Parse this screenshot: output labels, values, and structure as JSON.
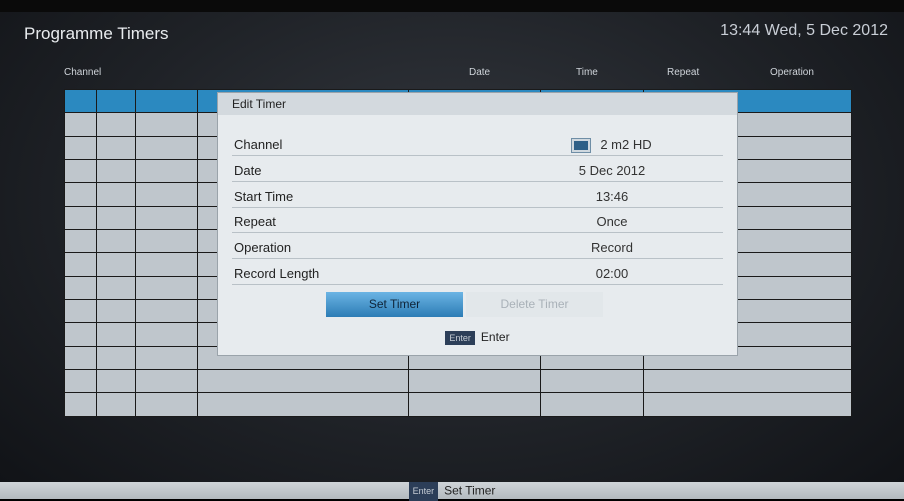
{
  "header": {
    "title": "Programme Timers",
    "clock": "13:44 Wed, 5 Dec 2012"
  },
  "table": {
    "columns": [
      "Channel",
      "Date",
      "Time",
      "Repeat",
      "Operation"
    ]
  },
  "dialog": {
    "title": "Edit Timer",
    "fields": [
      {
        "label": "Channel",
        "value": "2 m2 HD"
      },
      {
        "label": "Date",
        "value": "5 Dec 2012"
      },
      {
        "label": "Start Time",
        "value": "13:46"
      },
      {
        "label": "Repeat",
        "value": "Once"
      },
      {
        "label": "Operation",
        "value": "Record"
      },
      {
        "label": "Record Length",
        "value": "02:00"
      }
    ],
    "buttons": {
      "set_timer": "Set Timer",
      "delete_timer": "Delete Timer"
    },
    "hint": {
      "key": "Enter",
      "action": "Enter"
    },
    "channel_icon": "tv-icon"
  },
  "footer": {
    "key": "Enter",
    "action": "Set Timer"
  },
  "colors": {
    "highlight": "#2b89c0",
    "dialog_bg": "#e7ebee",
    "table_bg": "#bfc6cc"
  }
}
